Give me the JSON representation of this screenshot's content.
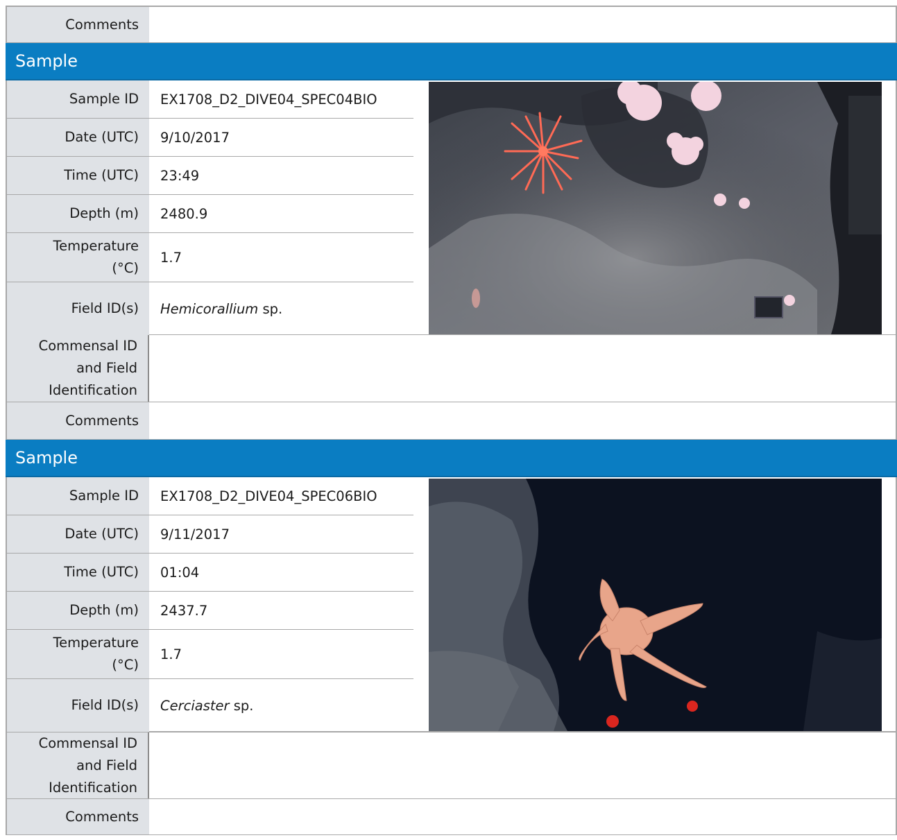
{
  "labels": {
    "comments": "Comments",
    "section_title": "Sample",
    "sample_id": "Sample ID",
    "date": "Date (UTC)",
    "time": "Time (UTC)",
    "depth": "Depth (m)",
    "temperature_line1": "Temperature",
    "temperature_line2": "(°C)",
    "field_id": "Field ID(s)",
    "commensal_line1": "Commensal ID",
    "commensal_line2": "and Field",
    "commensal_line3": "Identification"
  },
  "samples": [
    {
      "sample_id": "EX1708_D2_DIVE04_SPEC04BIO",
      "date": "9/10/2017",
      "time": "23:49",
      "depth": "2480.9",
      "temperature": "1.7",
      "field_id_genus": "Hemicorallium",
      "field_id_suffix": " sp."
    },
    {
      "sample_id": "EX1708_D2_DIVE04_SPEC06BIO",
      "date": "9/11/2017",
      "time": "01:04",
      "depth": "2437.7",
      "temperature": "1.7",
      "field_id_genus": "Cerciaster",
      "field_id_suffix": " sp."
    }
  ]
}
